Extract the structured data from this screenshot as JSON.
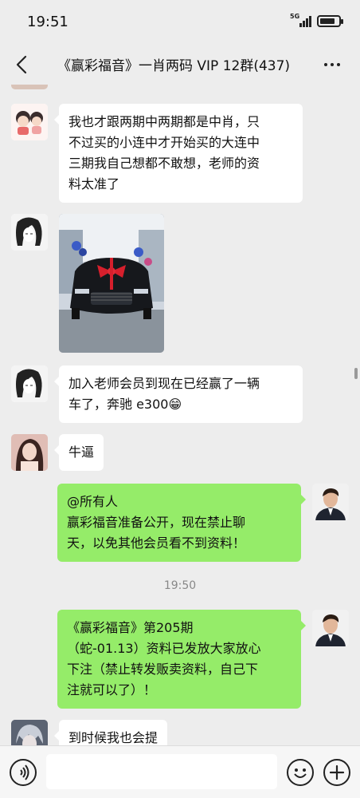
{
  "status_bar": {
    "time": "19:51",
    "network": "5G",
    "signal_icon": "signal-icon",
    "battery_icon": "battery-icon",
    "battery_level": 0.8
  },
  "header": {
    "back_icon": "chevron-left-icon",
    "title": "《赢彩福音》一肖两码 VIP 12群(437)",
    "more_icon": "more-icon"
  },
  "colors": {
    "background": "#ededed",
    "incoming_bubble": "#ffffff",
    "outgoing_bubble": "#95ec69"
  },
  "messages": [
    {
      "direction": "incoming",
      "avatar": "cartoon-girl-avatar",
      "lines": [
        "我也才跟两期中两期都是中肖，只",
        "不过买的小连中才开始买的大连中",
        "三期我自己想都不敢想，老师的资",
        "料太准了"
      ]
    },
    {
      "direction": "incoming",
      "avatar": "sketch-girl-avatar",
      "type": "image",
      "image": "black-mercedes-car-photo"
    },
    {
      "direction": "incoming",
      "avatar": "sketch-girl-avatar",
      "lines": [
        "加入老师会员到现在已经赢了一辆",
        "车了，奔驰 e300😁"
      ]
    },
    {
      "direction": "incoming",
      "avatar": "girl-photo-avatar",
      "lines": [
        "牛逼"
      ]
    },
    {
      "direction": "outgoing",
      "avatar": "man-in-suit-avatar",
      "lines": [
        "@所有人",
        "赢彩福音准备公开，现在禁止聊",
        "天，以免其他会员看不到资料！"
      ]
    },
    {
      "direction": "outgoing",
      "avatar": "man-in-suit-avatar",
      "lines": [
        "《赢彩福音》第205期",
        "（蛇-01.13）资料已发放大家放心",
        "下注（禁止转发贩卖资料，自己下",
        "注就可以了）！"
      ]
    },
    {
      "direction": "incoming",
      "avatar": "anime-boy-avatar",
      "lines": [
        "到时候我也会提"
      ]
    }
  ],
  "timestamp": "19:50",
  "input_bar": {
    "voice_icon": "voice-icon",
    "placeholder": "",
    "emoji_icon": "emoji-icon",
    "plus_icon": "plus-icon"
  }
}
